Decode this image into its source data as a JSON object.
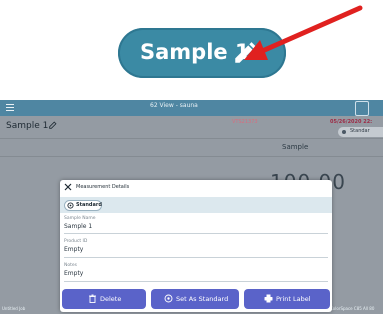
{
  "callout": {
    "label": "Sample 1",
    "icon": "pencil-icon",
    "color": "#3b8aa4",
    "arrow_color": "#e0211f"
  },
  "app": {
    "topbar_title": "62 View - sauna",
    "meta_line": "VTS21373",
    "meta_date": "05/26/2020 22:",
    "standard_pill": "Standar",
    "sample_header": "Sample 1",
    "column_header": "Sample",
    "big_value": "100.00",
    "footer_left": "Untitled Job",
    "footer_right": "ColorSpace C85 All 80"
  },
  "modal": {
    "title": "Measurement Details",
    "standard_chip": "Standard",
    "fields": [
      {
        "label": "Sample Name",
        "value": "Sample 1"
      },
      {
        "label": "Product ID",
        "value": "Empty"
      },
      {
        "label": "Notes",
        "value": "Empty"
      }
    ],
    "buttons": {
      "delete": "Delete",
      "set_standard": "Set As Standard",
      "print": "Print Label"
    },
    "button_color": "#5a63c9"
  }
}
